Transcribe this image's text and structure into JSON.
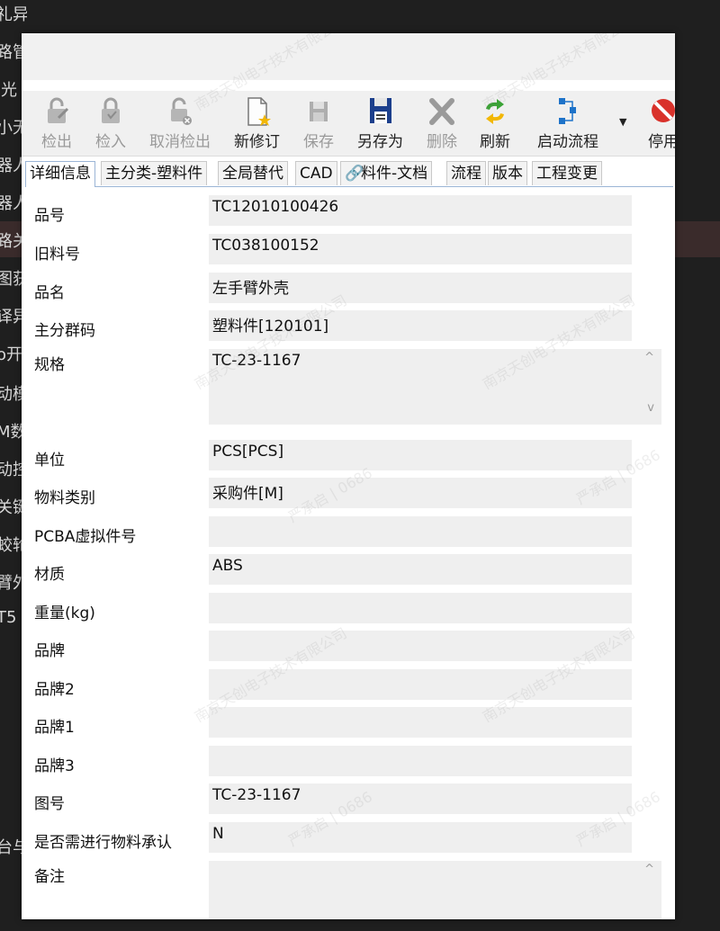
{
  "background": {
    "items": [
      "礼异响",
      "路管",
      "l光",
      "小无",
      "器人",
      "器人",
      "路关",
      "图获",
      "译异",
      "o开",
      "动模",
      "M数",
      "动控",
      "关键",
      "蛟轮",
      "臂外",
      "T5",
      "台与"
    ]
  },
  "toolbar": {
    "buttons": [
      {
        "label": "检出",
        "icon": "checkout-icon",
        "disabled": true
      },
      {
        "label": "检入",
        "icon": "checkin-icon",
        "disabled": true
      },
      {
        "label": "取消检出",
        "icon": "cancel-checkout-icon",
        "disabled": true
      },
      {
        "label": "新修订",
        "icon": "new-revision-icon",
        "disabled": false
      },
      {
        "label": "保存",
        "icon": "save-icon",
        "disabled": true
      },
      {
        "label": "另存为",
        "icon": "save-as-icon",
        "disabled": false
      },
      {
        "label": "删除",
        "icon": "delete-icon",
        "disabled": true
      },
      {
        "label": "刷新",
        "icon": "refresh-icon",
        "disabled": false
      },
      {
        "label": "启动流程",
        "icon": "start-workflow-icon",
        "disabled": false
      },
      {
        "label": "停用",
        "icon": "disable-icon",
        "disabled": false
      }
    ]
  },
  "tabs": [
    "详细信息",
    "主分类-塑料件",
    "全局替代",
    "CAD",
    "料件-文档",
    "流程",
    "版本",
    "工程变更"
  ],
  "fields": [
    {
      "label": "品号",
      "value": "TC12010100426"
    },
    {
      "label": "旧料号",
      "value": "TC038100152"
    },
    {
      "label": "品名",
      "value": "左手臂外壳"
    },
    {
      "label": "主分群码",
      "value": "塑料件[120101]"
    },
    {
      "label": "规格",
      "value": "TC-23-1167"
    },
    {
      "label": "单位",
      "value": "PCS[PCS]"
    },
    {
      "label": "物料类别",
      "value": "采购件[M]"
    },
    {
      "label": "PCBA虚拟件号",
      "value": ""
    },
    {
      "label": "材质",
      "value": "ABS"
    },
    {
      "label": "重量(kg)",
      "value": ""
    },
    {
      "label": "品牌",
      "value": ""
    },
    {
      "label": "品牌2",
      "value": ""
    },
    {
      "label": "品牌1",
      "value": ""
    },
    {
      "label": "品牌3",
      "value": ""
    },
    {
      "label": "图号",
      "value": "TC-23-1167"
    },
    {
      "label": "是否需进行物料承认",
      "value": "N"
    },
    {
      "label": "备注",
      "value": ""
    }
  ],
  "scroll": {
    "up": "^",
    "down": "v"
  },
  "watermarks": [
    "南京天创电子技术有限公司",
    "严承启 | 0686"
  ],
  "colors": {
    "field_bg": "#efefef",
    "tab_border": "#9bb5d6",
    "refresh_green": "#3aa335",
    "workflow_blue": "#1e73c9",
    "disable_red": "#d9322b"
  }
}
